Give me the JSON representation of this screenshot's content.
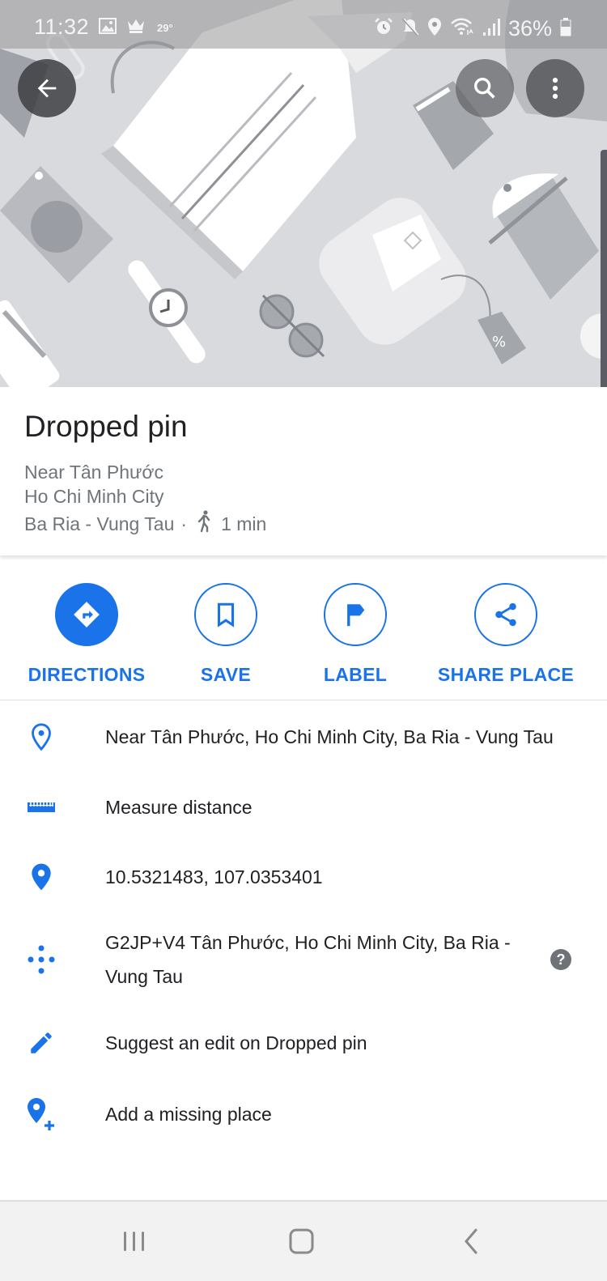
{
  "status_bar": {
    "time": "11:32",
    "temperature": "29°",
    "battery_percent": "36%",
    "left_icons": [
      "gallery-icon",
      "crown-icon",
      "temperature-text"
    ],
    "right_icons": [
      "alarm-icon",
      "mute-icon",
      "location-icon",
      "wifi-icon",
      "signal-icon",
      "battery-icon"
    ]
  },
  "header": {
    "back_icon": "arrow-back-icon",
    "search_icon": "search-icon",
    "more_icon": "more-vert-icon"
  },
  "place": {
    "title": "Dropped pin",
    "line1": "Near Tân Phước",
    "line2": "Ho Chi Minh City",
    "line3": "Ba Ria - Vung Tau",
    "separator": "·",
    "walk_time": "1 min"
  },
  "actions": [
    {
      "label": "DIRECTIONS",
      "icon": "directions-icon"
    },
    {
      "label": "SAVE",
      "icon": "bookmark-icon"
    },
    {
      "label": "LABEL",
      "icon": "flag-icon"
    },
    {
      "label": "SHARE PLACE",
      "icon": "share-icon"
    }
  ],
  "details": [
    {
      "icon": "location-outline-icon",
      "text": "Near Tân Phước, Ho Chi Minh City, Ba Ria - Vung Tau"
    },
    {
      "icon": "ruler-icon",
      "text": "Measure distance"
    },
    {
      "icon": "location-pin-icon",
      "text": "10.5321483, 107.0353401"
    },
    {
      "icon": "plus-code-icon",
      "text": "G2JP+V4 Tân Phước, Ho Chi Minh City, Ba Ria - Vung Tau",
      "help": "?"
    },
    {
      "icon": "pencil-icon",
      "text": "Suggest an edit on Dropped pin"
    },
    {
      "icon": "add-location-icon",
      "text": "Add a missing place"
    }
  ],
  "colors": {
    "accent": "#1a73e8",
    "title_text": "#202124",
    "secondary_text": "#70757a"
  },
  "nav_bar": {
    "buttons": [
      "recent-apps",
      "home",
      "back"
    ]
  }
}
